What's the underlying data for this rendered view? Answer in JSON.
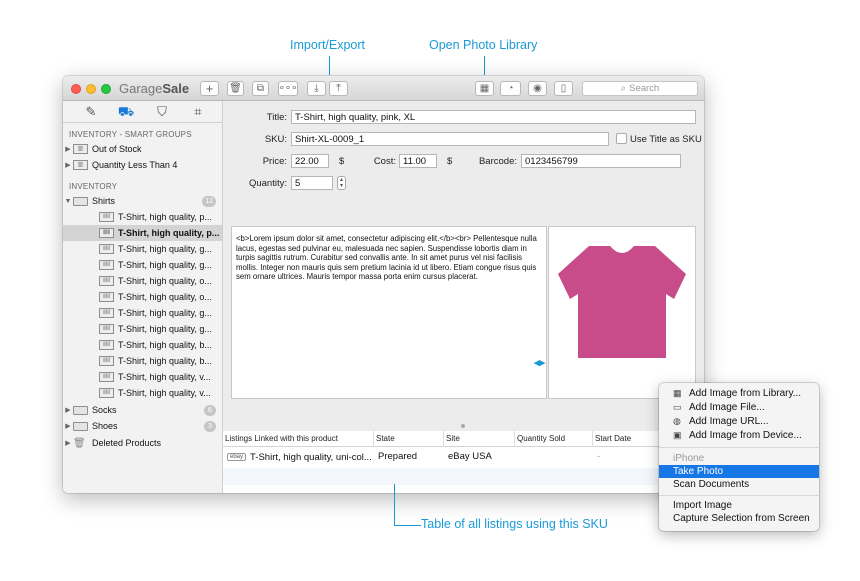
{
  "callouts": {
    "import_export": "Import/Export",
    "photo_library": "Open Photo Library",
    "table_listings": "Table of all listings using this SKU"
  },
  "app": {
    "title_light": "Garage",
    "title_bold": "Sale"
  },
  "toolbar": {
    "add": "+",
    "search_placeholder": "Search"
  },
  "sidebar": {
    "smart_groups_header": "INVENTORY - SMART GROUPS",
    "smart_groups": [
      "Out of Stock",
      "Quantity Less Than 4"
    ],
    "inventory_header": "INVENTORY",
    "shirts": {
      "label": "Shirts",
      "count": "12"
    },
    "shirt_items": [
      "T-Shirt, high quality, p...",
      "T-Shirt, high quality, p...",
      "T-Shirt, high quality, g...",
      "T-Shirt, high quality, g...",
      "T-Shirt, high quality, o...",
      "T-Shirt, high quality, o...",
      "T-Shirt, high quality, g...",
      "T-Shirt, high quality, g...",
      "T-Shirt, high quality, b...",
      "T-Shirt, high quality, b...",
      "T-Shirt, high quality, v...",
      "T-Shirt, high quality, v..."
    ],
    "socks": {
      "label": "Socks",
      "count": "6"
    },
    "shoes": {
      "label": "Shoes",
      "count": "3"
    },
    "deleted": "Deleted Products"
  },
  "form": {
    "title_label": "Title:",
    "title_value": "T-Shirt, high quality, pink, XL",
    "sku_label": "SKU:",
    "sku_value": "Shirt-XL-0009_1",
    "use_title_label": "Use Title as SKU",
    "price_label": "Price:",
    "price_value": "22.00",
    "currency": "$",
    "cost_label": "Cost:",
    "cost_value": "11.00",
    "barcode_label": "Barcode:",
    "barcode_value": "0123456799",
    "quantity_label": "Quantity:",
    "quantity_value": "5",
    "description": "<b>Lorem ipsum dolor sit amet, consectetur adipiscing elit.</b><br> Pellentesque nulla lacus, egestas sed pulvinar eu, malesuada nec sapien. Suspendisse lobortis diam in turpis sagittis rutrum. Curabitur sed convallis ante. In sit amet purus vel nisi facilisis mollis. Integer non mauris quis sem pretium lacinia id ut libero. Etiam congue risus quis sem ornare ultrices. Mauris tempor massa porta enim cursus placerat."
  },
  "product_image": {
    "color": "#c94c8a"
  },
  "table": {
    "headers": [
      "Listings Linked with this product",
      "State",
      "Site",
      "Quantity Sold",
      "Start Date"
    ],
    "row": {
      "badge": "ebay",
      "title": "T-Shirt, high quality, uni-col...",
      "state": "Prepared",
      "site": "eBay USA",
      "start": "-"
    }
  },
  "menu": {
    "items_top": [
      "Add Image from Library...",
      "Add Image File...",
      "Add Image URL...",
      "Add Image from Device..."
    ],
    "section_label": "iPhone",
    "iphone_items": [
      "Take Photo",
      "Scan Documents"
    ],
    "items_bottom": [
      "Import Image",
      "Capture Selection from Screen"
    ]
  },
  "colors": {
    "accent": "#1a9ad6",
    "selection": "#1877e6"
  }
}
